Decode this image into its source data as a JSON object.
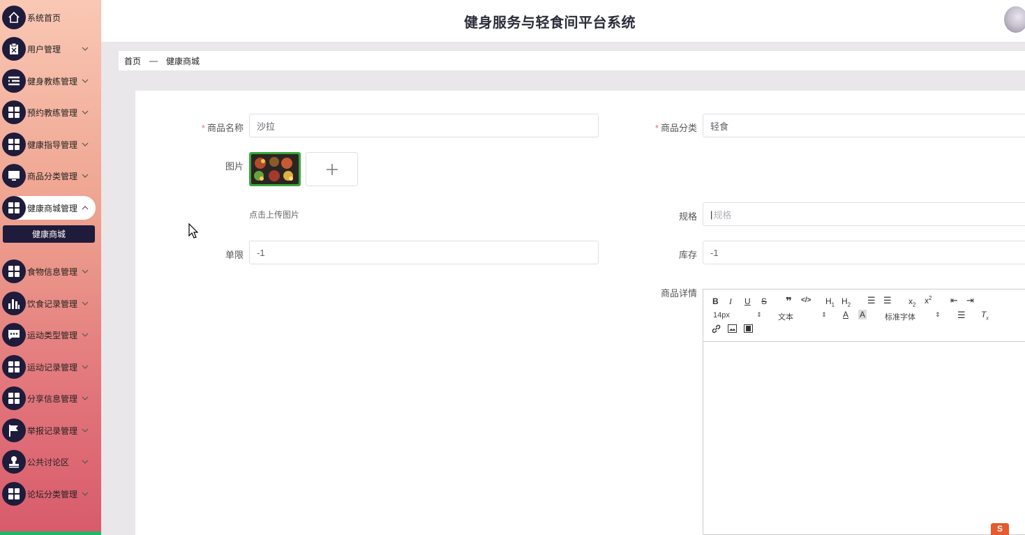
{
  "app": {
    "title": "健身服务与轻食间平台系统"
  },
  "sidebar": {
    "items": [
      {
        "label": "系统首页",
        "icon": "home-icon",
        "expandable": false
      },
      {
        "label": "用户管理",
        "icon": "clipboard-icon",
        "expandable": true
      },
      {
        "label": "健身教练管理",
        "icon": "list-icon",
        "expandable": true
      },
      {
        "label": "预约教练管理",
        "icon": "grid-icon",
        "expandable": true
      },
      {
        "label": "健康指导管理",
        "icon": "grid-icon",
        "expandable": true
      },
      {
        "label": "商品分类管理",
        "icon": "monitor-icon",
        "expandable": true
      },
      {
        "label": "健康商城管理",
        "icon": "grid-icon",
        "expandable": true,
        "expanded": true
      },
      {
        "label": "食物信息管理",
        "icon": "grid-icon",
        "expandable": true
      },
      {
        "label": "饮食记录管理",
        "icon": "bar-chart-icon",
        "expandable": true
      },
      {
        "label": "运动类型管理",
        "icon": "chat-icon",
        "expandable": true
      },
      {
        "label": "运动记录管理",
        "icon": "grid-icon",
        "expandable": true
      },
      {
        "label": "分享信息管理",
        "icon": "grid-icon",
        "expandable": true
      },
      {
        "label": "举报记录管理",
        "icon": "flag-icon",
        "expandable": true
      },
      {
        "label": "公共讨论区",
        "icon": "stamp-icon",
        "expandable": true
      },
      {
        "label": "论坛分类管理",
        "icon": "grid-icon",
        "expandable": true
      }
    ],
    "submenu": {
      "label": "健康商城"
    }
  },
  "breadcrumb": {
    "home": "首页",
    "separator": "—",
    "current": "健康商城"
  },
  "form": {
    "name": {
      "label": "商品名称",
      "value": "沙拉"
    },
    "category": {
      "label": "商品分类",
      "value": "轻食"
    },
    "image": {
      "label": "图片",
      "hint": "点击上传图片"
    },
    "spec": {
      "label": "规格",
      "placeholder": "规格"
    },
    "limit": {
      "label": "单限",
      "value": "-1"
    },
    "stock": {
      "label": "库存",
      "value": "-1"
    },
    "detail": {
      "label": "商品详情"
    }
  },
  "editor": {
    "font_size": "14px",
    "text_type": "文本",
    "font_family": "标准字体"
  },
  "colors": {
    "sidebar_top": "#f9c8b4",
    "sidebar_bottom": "#d85b6b",
    "icon_bg": "#1f1b3a",
    "required": "#f56c6c"
  }
}
